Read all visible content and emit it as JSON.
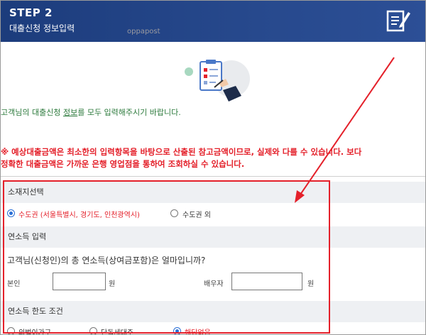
{
  "header": {
    "step": "STEP 2",
    "title": "대출신청 정보입력"
  },
  "watermark": "oppapost",
  "intro": {
    "before": "고객님의 대출신청 ",
    "emphasis": "정보",
    "after": "를 모두 입력해주시기 바랍니다."
  },
  "notice": {
    "line1": "※ 예상대출금액은 최소한의 입력항목을 바탕으로 산출된 참고금액이므로, 실제와 다를 수 있습니다. 보다",
    "line2": "정확한 대출금액은 가까운 은행 영업점을 통하여 조회하실 수 있습니다."
  },
  "location": {
    "heading": "소재지선택",
    "options": [
      {
        "label": "수도권 (서울특별시, 경기도, 인천광역시)",
        "selected": true
      },
      {
        "label": "수도권 외",
        "selected": false
      }
    ]
  },
  "income": {
    "heading": "연소득 입력",
    "question": "고객님(신청인)의 총 연소득(상여금포함)은 얼마입니까?",
    "self_label": "본인",
    "spouse_label": "배우자",
    "unit": "원",
    "self_value": "",
    "spouse_value": ""
  },
  "limit": {
    "heading": "연소득 한도 조건",
    "options": [
      {
        "label": "외벌이가구",
        "selected": false
      },
      {
        "label": "단독세대주",
        "selected": false
      },
      {
        "label": "해당없음",
        "selected": true
      }
    ]
  },
  "colors": {
    "header_bg": "#27498d",
    "accent_red": "#e4202a",
    "radio_blue": "#2a6fd6",
    "intro_green": "#2c7a3c",
    "section_bg": "#eef0f3"
  }
}
